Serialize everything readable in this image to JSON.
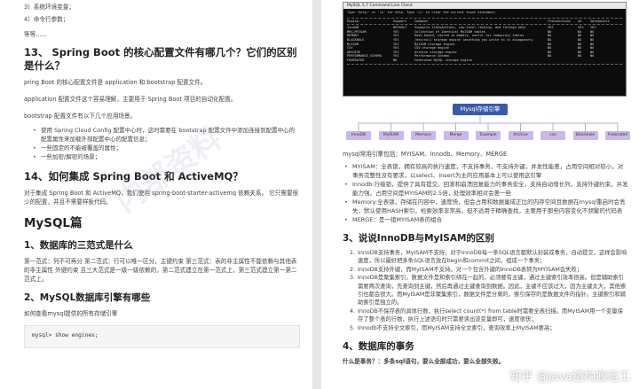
{
  "left": {
    "top_items": [
      "3）系统环境变量；",
      "4）命令行参数；"
    ],
    "etc": "等等......",
    "q13": {
      "title": "13、 Spring Boot 的核心配置文件有哪几个？它们的区别是什么？",
      "p1": "pring Boot 的核心配置文件是 application 和 bootstrap 配置文件。",
      "p2": "application 配置文件这个容易理解，主要用于 Spring Boot 项目的自动化配置。",
      "p3": "bootstrap 配置文件有以下几个应用场景。",
      "bullets": [
        "使用 Spring Cloud Config 配置中心时，这时需要在 bootstrap 配置文件中添加连接到配置中心的配置属性来加载外部配置中心的配置信息；",
        "一些固定的不能被覆盖的属性；",
        "一些加密/解密的场景；"
      ]
    },
    "q14": {
      "title": "14、如何集成 Spring Boot 和 ActiveMQ？",
      "p1": "对于集成 Spring Boot 和 ActiveMQ，我们使用 spring-boot-starter-activemq 依赖关系。 它只需要很少的配置，并且不需要样板代码。"
    },
    "mysql_title": "MySQL篇",
    "s1": {
      "title": "1、数据库的三范式是什么",
      "p1": "第一范式：列不可再分 第二范式：行可以唯一区分，主键约束 第三范式：表的非主属性不能依赖与其他表的非主属性 外键约束 且三大范式是一级一级依赖的，第二范式建立在第一范式上，第三范式建立第一第二范式上。"
    },
    "s2": {
      "title": "2、MySQL数据库引擎有哪些",
      "p1": "如何查看mysql提供的所有存储引擎",
      "code": "mysql> show engines;"
    },
    "watermark": "内部资料"
  },
  "right": {
    "terminal": {
      "title": "MySQL 5.7 Command Line Client",
      "hint": "Type 'help;' or '\\h' for help. Type '\\c' to clear the current input statement.",
      "header": [
        "Engine",
        "Support",
        "Comment",
        "Transactions",
        "XA",
        "Savepoints"
      ],
      "rows": [
        [
          "InnoDB",
          "DEFAULT",
          "Supports transactions, row-level locking, and foreign keys",
          "YES",
          "YES",
          "YES"
        ],
        [
          "MRG_MYISAM",
          "YES",
          "Collection of identical MyISAM tables",
          "NO",
          "NO",
          "NO"
        ],
        [
          "MEMORY",
          "YES",
          "Hash based, stored in memory, useful for temporary tables",
          "NO",
          "NO",
          "NO"
        ],
        [
          "BLACKHOLE",
          "YES",
          "/dev/null storage engine (anything you write to it disappears)",
          "NO",
          "NO",
          "NO"
        ],
        [
          "MyISAM",
          "YES",
          "MyISAM storage engine",
          "NO",
          "NO",
          "NO"
        ],
        [
          "CSV",
          "YES",
          "CSV storage engine",
          "NO",
          "NO",
          "NO"
        ],
        [
          "ARCHIVE",
          "YES",
          "Archive storage engine",
          "NO",
          "NO",
          "NO"
        ],
        [
          "PERFORMANCE_SCHEMA",
          "YES",
          "Performance Schema",
          "NO",
          "NO",
          "NO"
        ],
        [
          "FEDERATED",
          "NO",
          "Federated MySQL storage engine",
          "",
          "",
          ""
        ]
      ]
    },
    "diagram": {
      "root": "Mysql存储引擎",
      "leaves": [
        "InnoDB",
        "MyISAM",
        "Memory",
        "Merge",
        "Example",
        "Archive",
        "csv",
        "Blackhole",
        "Federated"
      ]
    },
    "engines_line": "mysql常用引擎包括：MYISAM、Innodb、Memory、MERGE",
    "engine_bullets": [
      "MYISAM：全表锁，拥有较高的执行速度，不支持事务，不支持外键，并发性能差，占用空间相对较小，对事务完整性没有要求，以select、insert为主的应用基本上可以使用这引擎",
      "Innodb:行级锁，提供了具有提交、回滚和崩溃回复能力的事务安全，支持自动增长列，支持外键约束，并发能力强，占用空间是MYISAM的2.5倍，处理效率相对会差一些",
      "Memory:全表锁，存储在内容中，速度快，但会占用和数据量成正比的内存空间且数据在mysql重启时会丢失，默认使用HASH索引，检索效率非常高，但不适用于精确查找，主要用于那些内容变化不频繁的代码表",
      "MERGE：是一组MYISAM表的组合"
    ],
    "s3": {
      "title": "3、说说InnoDB与MyISAM的区别",
      "items": [
        "InnoDB支持事务，MyISAM不支持，对于InnoDB每一条SQL语言都默认封装成事务，自动提交，这样会影响速度，所以最好把多条SQL语言放在begin和commit之间，组成一个事务；",
        "InnoDB支持外键，而MyISAM不支持。对一个包含外键的InnoDB表转为MYISAM会失败；",
        "InnoDB是聚集索引，数据文件是和索引绑在一起的，必须要有主键，通过主键索引效率很高。但是辅助索引需要两次查询，先查询到主键，然后再通过主键查询到数据。因此，主键不应该过大，因为主键太大，其他索引也都会很大。而MyISAM是非聚集索引，数据文件是分离的，索引保存的是数据文件的指针。主键索引和辅助索引是独立的。",
        "InnoDB不保存表的具体行数，执行select count(*) from table时需要全表扫描。而MyISAM用一个变量保存了整个表的行数，执行上述语句时只需要读出该变量即可，速度很快；",
        "Innodb不支持全文索引，而MyISAM支持全文索引，查询效率上MyISAM要高；"
      ]
    },
    "s4": {
      "title": "4、数据库的事务",
      "p1": "什么是事务？：多条sql语句，要么全部成功，要么全部失败。"
    },
    "zhihu_mark": "知乎 @java结构搬运工",
    "colors": {
      "diagram_root": "#3a5aa8",
      "diagram_leaf": "#c9b8e8"
    }
  }
}
